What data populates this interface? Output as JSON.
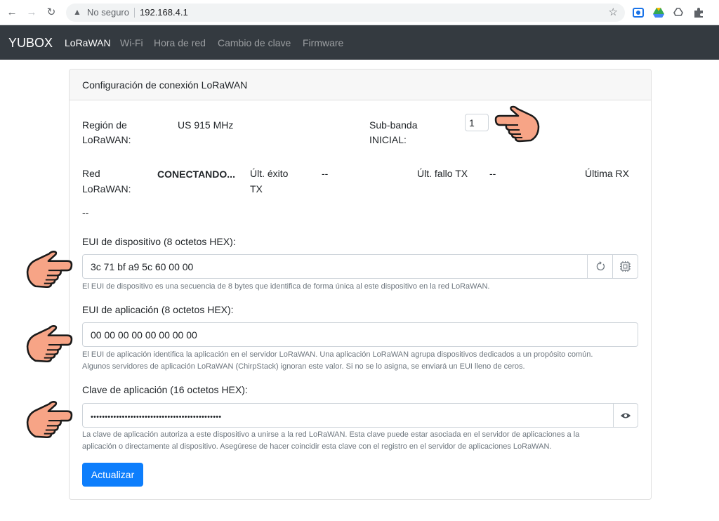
{
  "browser": {
    "security_label": "No seguro",
    "url": "192.168.4.1"
  },
  "navbar": {
    "brand": "YUBOX",
    "links": [
      "LoRaWAN",
      "Wi-Fi",
      "Hora de red",
      "Cambio de clave",
      "Firmware"
    ]
  },
  "card": {
    "title": "Configuración de conexión LoRaWAN",
    "region_label_1": "Región de",
    "region_label_2": "LoRaWAN:",
    "region_value": "US 915 MHz",
    "subband_label_1": "Sub-banda",
    "subband_label_2": "INICIAL:",
    "subband_value": "1",
    "net_label_1": "Red",
    "net_label_2": "LoRaWAN:",
    "net_value": "CONECTANDO...",
    "last_tx_ok_label_1": "Últ. éxito",
    "last_tx_ok_label_2": "TX",
    "last_tx_ok_value": "--",
    "last_tx_fail_label": "Últ. fallo TX",
    "last_tx_fail_value": "--",
    "last_rx_label": "Última RX",
    "last_rx_value": "--",
    "dev_eui": {
      "label": "EUI de dispositivo (8 octetos HEX):",
      "value": "3c 71 bf a9 5c 60 00 00",
      "help": "El EUI de dispositivo es una secuencia de 8 bytes que identifica de forma única al este dispositivo en la red LoRaWAN."
    },
    "app_eui": {
      "label": "EUI de aplicación (8 octetos HEX):",
      "value": "00 00 00 00 00 00 00 00",
      "help_1": "El EUI de aplicación identifica la aplicación en el servidor LoRaWAN. Una aplicación LoRaWAN agrupa dispositivos dedicados a un propósito común.",
      "help_2": "Algunos servidores de aplicación LoRaWAN (ChirpStack) ignoran este valor. Si no se lo asigna, se enviará un EUI lleno de ceros."
    },
    "app_key": {
      "label": "Clave de aplicación (16 octetos HEX):",
      "value": "••••••••••••••••••••••••••••••••••••••••••••••",
      "help_1": "La clave de aplicación autoriza a este dispositivo a unirse a la red LoRaWAN. Esta clave puede estar asociada en el servidor de aplicaciones a la",
      "help_2": "aplicación o directamente al dispositivo. Asegúrese de hacer coincidir esta clave con el registro en el servidor de aplicaciones LoRaWAN."
    },
    "submit_label": "Actualizar"
  },
  "colors": {
    "navbar_bg": "#343a40",
    "primary": "#0d7efc",
    "hand_fill": "#f7a486"
  },
  "icons": [
    "back-arrow-icon",
    "forward-arrow-icon",
    "reload-icon",
    "warning-icon",
    "star-icon",
    "refresh-icon",
    "chip-icon",
    "eye-icon",
    "pointing-hand-icon"
  ]
}
